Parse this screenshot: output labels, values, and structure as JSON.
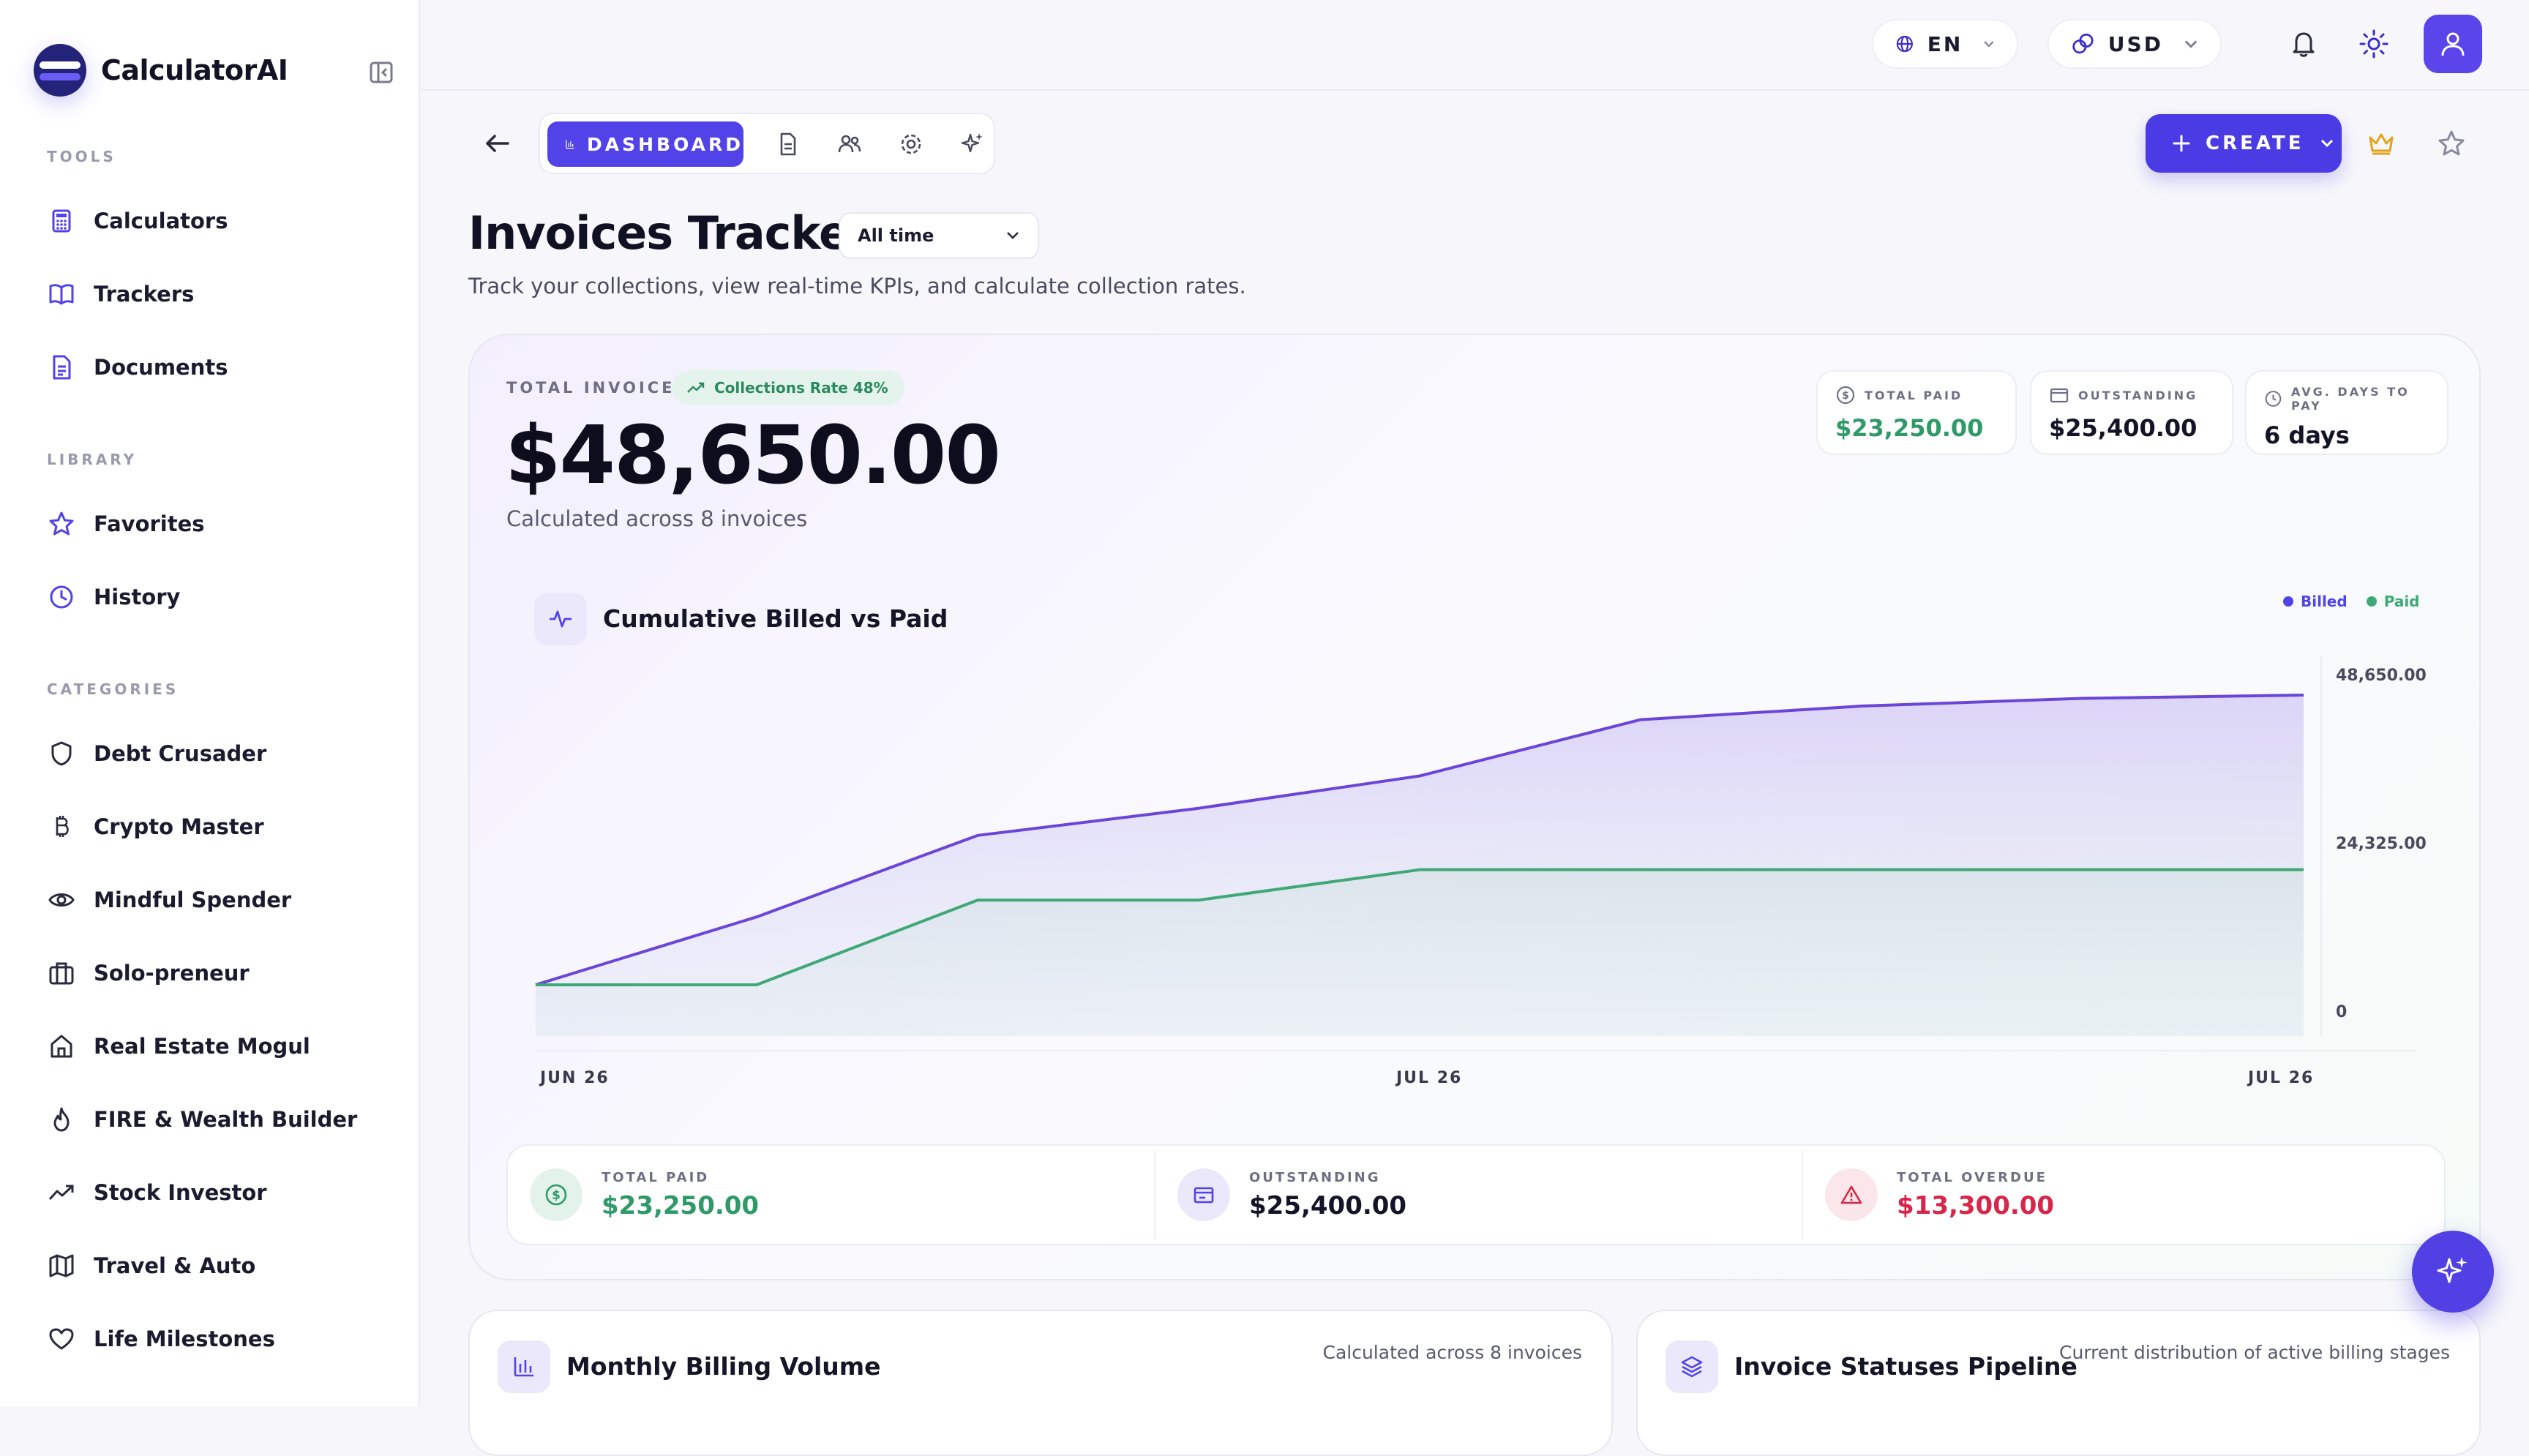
{
  "app": {
    "name": "CalculatorAI"
  },
  "sidebar": {
    "sections": {
      "tools": "TOOLS",
      "library": "LIBRARY",
      "categories": "CATEGORIES"
    },
    "tools": [
      {
        "label": "Calculators",
        "icon": "calculator-icon"
      },
      {
        "label": "Trackers",
        "icon": "book-open-icon"
      },
      {
        "label": "Documents",
        "icon": "document-icon"
      }
    ],
    "library": [
      {
        "label": "Favorites",
        "icon": "star-icon"
      },
      {
        "label": "History",
        "icon": "clock-icon"
      }
    ],
    "categories": [
      {
        "label": "Debt Crusader",
        "icon": "shield-icon"
      },
      {
        "label": "Crypto Master",
        "icon": "bitcoin-icon"
      },
      {
        "label": "Mindful Spender",
        "icon": "eye-icon"
      },
      {
        "label": "Solo-preneur",
        "icon": "briefcase-icon"
      },
      {
        "label": "Real Estate Mogul",
        "icon": "home-icon"
      },
      {
        "label": "FIRE & Wealth Builder",
        "icon": "flame-icon"
      },
      {
        "label": "Stock Investor",
        "icon": "trending-up-icon"
      },
      {
        "label": "Travel & Auto",
        "icon": "map-icon"
      },
      {
        "label": "Life Milestones",
        "icon": "heart-icon"
      }
    ]
  },
  "header": {
    "language": "EN",
    "currency": "USD"
  },
  "toolbar": {
    "active_tab": "DASHBOARD",
    "create_label": "CREATE"
  },
  "page": {
    "title": "Invoices Tracker",
    "range": "All time",
    "subtitle": "Track your collections, view real-time KPIs, and calculate collection rates."
  },
  "summary": {
    "total_invoiced_label": "TOTAL INVOICED",
    "rate_badge": "Collections Rate 48%",
    "total_invoiced": "$48,650.00",
    "calc_note": "Calculated across 8 invoices",
    "mini": [
      {
        "label": "TOTAL PAID",
        "value": "$23,250.00",
        "icon": "dollar-circle-icon"
      },
      {
        "label": "OUTSTANDING",
        "value": "$25,400.00",
        "icon": "wallet-icon"
      },
      {
        "label": "AVG. DAYS TO PAY",
        "value": "6 days",
        "icon": "clock-icon"
      }
    ],
    "strip": [
      {
        "label": "TOTAL PAID",
        "value": "$23,250.00",
        "icon": "dollar-circle-icon"
      },
      {
        "label": "OUTSTANDING",
        "value": "$25,400.00",
        "icon": "wallet-icon"
      },
      {
        "label": "TOTAL OVERDUE",
        "value": "$13,300.00",
        "icon": "alert-triangle-icon"
      }
    ]
  },
  "colors": {
    "accent": "#5243e8",
    "billed": "#6a45d8",
    "paid": "#3fa877",
    "overdue": "#d8264a"
  },
  "chart_data": {
    "type": "area",
    "title": "Cumulative Billed vs Paid",
    "x_tick_labels": [
      "JUN 26",
      "JUL 26",
      "JUL 26"
    ],
    "y_tick_labels": [
      "48,650.00",
      "24,325.00",
      "0"
    ],
    "ylim": [
      0,
      48650
    ],
    "series": [
      {
        "name": "Billed",
        "values": [
          0,
          10500,
          23100,
          27300,
          32300,
          41000,
          43100,
          44300,
          44800
        ]
      },
      {
        "name": "Paid",
        "values": [
          0,
          0,
          13100,
          13100,
          17800,
          17800,
          17800,
          17800,
          17800
        ]
      }
    ],
    "legend_position": "top-right"
  },
  "bottom": {
    "left": {
      "title": "Monthly Billing Volume",
      "note": "Calculated across 8 invoices"
    },
    "right": {
      "title": "Invoice Statuses Pipeline",
      "note": "Current distribution of active billing stages"
    }
  }
}
